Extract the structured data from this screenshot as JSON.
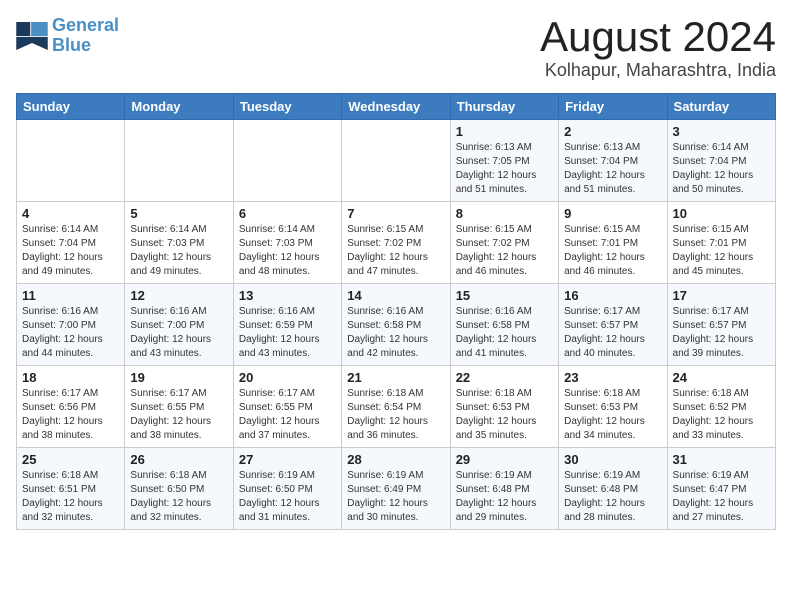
{
  "header": {
    "logo_line1": "General",
    "logo_line2": "Blue",
    "main_title": "August 2024",
    "subtitle": "Kolhapur, Maharashtra, India"
  },
  "calendar": {
    "days_of_week": [
      "Sunday",
      "Monday",
      "Tuesday",
      "Wednesday",
      "Thursday",
      "Friday",
      "Saturday"
    ],
    "weeks": [
      [
        {
          "day": "",
          "info": ""
        },
        {
          "day": "",
          "info": ""
        },
        {
          "day": "",
          "info": ""
        },
        {
          "day": "",
          "info": ""
        },
        {
          "day": "1",
          "info": "Sunrise: 6:13 AM\nSunset: 7:05 PM\nDaylight: 12 hours\nand 51 minutes."
        },
        {
          "day": "2",
          "info": "Sunrise: 6:13 AM\nSunset: 7:04 PM\nDaylight: 12 hours\nand 51 minutes."
        },
        {
          "day": "3",
          "info": "Sunrise: 6:14 AM\nSunset: 7:04 PM\nDaylight: 12 hours\nand 50 minutes."
        }
      ],
      [
        {
          "day": "4",
          "info": "Sunrise: 6:14 AM\nSunset: 7:04 PM\nDaylight: 12 hours\nand 49 minutes."
        },
        {
          "day": "5",
          "info": "Sunrise: 6:14 AM\nSunset: 7:03 PM\nDaylight: 12 hours\nand 49 minutes."
        },
        {
          "day": "6",
          "info": "Sunrise: 6:14 AM\nSunset: 7:03 PM\nDaylight: 12 hours\nand 48 minutes."
        },
        {
          "day": "7",
          "info": "Sunrise: 6:15 AM\nSunset: 7:02 PM\nDaylight: 12 hours\nand 47 minutes."
        },
        {
          "day": "8",
          "info": "Sunrise: 6:15 AM\nSunset: 7:02 PM\nDaylight: 12 hours\nand 46 minutes."
        },
        {
          "day": "9",
          "info": "Sunrise: 6:15 AM\nSunset: 7:01 PM\nDaylight: 12 hours\nand 46 minutes."
        },
        {
          "day": "10",
          "info": "Sunrise: 6:15 AM\nSunset: 7:01 PM\nDaylight: 12 hours\nand 45 minutes."
        }
      ],
      [
        {
          "day": "11",
          "info": "Sunrise: 6:16 AM\nSunset: 7:00 PM\nDaylight: 12 hours\nand 44 minutes."
        },
        {
          "day": "12",
          "info": "Sunrise: 6:16 AM\nSunset: 7:00 PM\nDaylight: 12 hours\nand 43 minutes."
        },
        {
          "day": "13",
          "info": "Sunrise: 6:16 AM\nSunset: 6:59 PM\nDaylight: 12 hours\nand 43 minutes."
        },
        {
          "day": "14",
          "info": "Sunrise: 6:16 AM\nSunset: 6:58 PM\nDaylight: 12 hours\nand 42 minutes."
        },
        {
          "day": "15",
          "info": "Sunrise: 6:16 AM\nSunset: 6:58 PM\nDaylight: 12 hours\nand 41 minutes."
        },
        {
          "day": "16",
          "info": "Sunrise: 6:17 AM\nSunset: 6:57 PM\nDaylight: 12 hours\nand 40 minutes."
        },
        {
          "day": "17",
          "info": "Sunrise: 6:17 AM\nSunset: 6:57 PM\nDaylight: 12 hours\nand 39 minutes."
        }
      ],
      [
        {
          "day": "18",
          "info": "Sunrise: 6:17 AM\nSunset: 6:56 PM\nDaylight: 12 hours\nand 38 minutes."
        },
        {
          "day": "19",
          "info": "Sunrise: 6:17 AM\nSunset: 6:55 PM\nDaylight: 12 hours\nand 38 minutes."
        },
        {
          "day": "20",
          "info": "Sunrise: 6:17 AM\nSunset: 6:55 PM\nDaylight: 12 hours\nand 37 minutes."
        },
        {
          "day": "21",
          "info": "Sunrise: 6:18 AM\nSunset: 6:54 PM\nDaylight: 12 hours\nand 36 minutes."
        },
        {
          "day": "22",
          "info": "Sunrise: 6:18 AM\nSunset: 6:53 PM\nDaylight: 12 hours\nand 35 minutes."
        },
        {
          "day": "23",
          "info": "Sunrise: 6:18 AM\nSunset: 6:53 PM\nDaylight: 12 hours\nand 34 minutes."
        },
        {
          "day": "24",
          "info": "Sunrise: 6:18 AM\nSunset: 6:52 PM\nDaylight: 12 hours\nand 33 minutes."
        }
      ],
      [
        {
          "day": "25",
          "info": "Sunrise: 6:18 AM\nSunset: 6:51 PM\nDaylight: 12 hours\nand 32 minutes."
        },
        {
          "day": "26",
          "info": "Sunrise: 6:18 AM\nSunset: 6:50 PM\nDaylight: 12 hours\nand 32 minutes."
        },
        {
          "day": "27",
          "info": "Sunrise: 6:19 AM\nSunset: 6:50 PM\nDaylight: 12 hours\nand 31 minutes."
        },
        {
          "day": "28",
          "info": "Sunrise: 6:19 AM\nSunset: 6:49 PM\nDaylight: 12 hours\nand 30 minutes."
        },
        {
          "day": "29",
          "info": "Sunrise: 6:19 AM\nSunset: 6:48 PM\nDaylight: 12 hours\nand 29 minutes."
        },
        {
          "day": "30",
          "info": "Sunrise: 6:19 AM\nSunset: 6:48 PM\nDaylight: 12 hours\nand 28 minutes."
        },
        {
          "day": "31",
          "info": "Sunrise: 6:19 AM\nSunset: 6:47 PM\nDaylight: 12 hours\nand 27 minutes."
        }
      ]
    ]
  }
}
